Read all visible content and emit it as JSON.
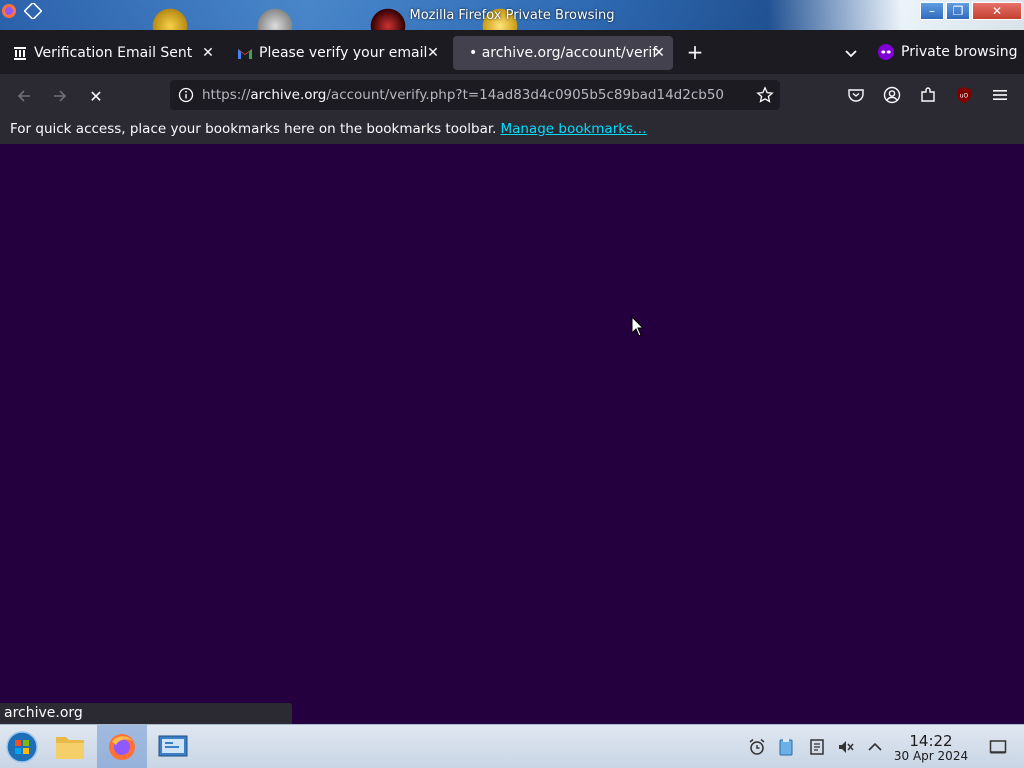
{
  "window": {
    "title": "Mozilla Firefox Private Browsing",
    "buttons": [
      "–",
      "❐",
      "✕"
    ]
  },
  "tabs": [
    {
      "label": "Verification Email Sent",
      "icon": "archive-icon",
      "active": false
    },
    {
      "label": "Please verify your email",
      "icon": "gmail-icon",
      "active": false
    },
    {
      "label": "• archive.org/account/verif",
      "icon": "loading-dot",
      "active": true
    }
  ],
  "tabbar": {
    "new_tab": "+",
    "private_label": "Private browsing"
  },
  "navbar": {
    "url_prefix": "https://",
    "url_host": "archive.org",
    "url_rest": "/account/verify.php?t=14ad83d4c0905b5c89bad14d2cb50",
    "stop_symbol": "✕"
  },
  "bookmarks": {
    "text": "For quick access, place your bookmarks here on the bookmarks toolbar.",
    "link": "Manage bookmarks…"
  },
  "status": {
    "text": "archive.org"
  },
  "colors": {
    "page_background": "#25003e",
    "toolbar": "#2b2a33",
    "tabbar": "#1c1b22",
    "link": "#00ddff"
  },
  "taskbar": {
    "time": "14:22",
    "date": "30 Apr 2024"
  }
}
